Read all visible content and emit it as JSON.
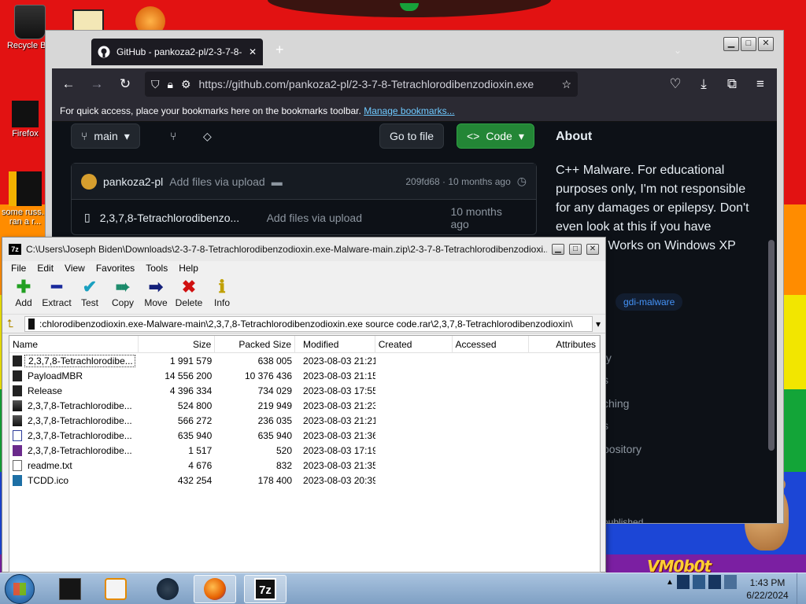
{
  "desktop": {
    "icons": [
      {
        "label": "Recycle Bin"
      },
      {
        "label": "Firefox"
      },
      {
        "label": "some russ... ran a r..."
      }
    ],
    "vm_logo": "VM0b0t"
  },
  "browser": {
    "tab_title": "GitHub - pankoza2-pl/2-3-7-8-",
    "url": "https://github.com/pankoza2-pl/2-3-7-8-Tetrachlorodibenzodioxin.exe",
    "bookmarks_hint": "For quick access, place your bookmarks here on the bookmarks toolbar.",
    "bookmarks_link": "Manage bookmarks...",
    "page": {
      "branch": "main",
      "go_to_file": "Go to file",
      "code_button": "Code",
      "commit": {
        "author": "pankoza2-pl",
        "message": "Add files via upload",
        "hash_time": "209fd68 · 10 months ago"
      },
      "file_row": {
        "name": "2,3,7,8-Tetrachlorodibenzo...",
        "message": "Add files via upload",
        "time": "10 months ago"
      },
      "about": {
        "title": "About",
        "description": "C++ Malware. For educational purposes only, I'm not responsible for any damages or epilepsy. Don't even look at this if you have epilepsy. Works on Windows XP and later",
        "topic": "gdi-malware",
        "links": [
          "ty",
          "s",
          "ching",
          "s",
          "pository",
          "published",
          "s"
        ]
      }
    }
  },
  "sevenzip": {
    "title": "C:\\Users\\Joseph Biden\\Downloads\\2-3-7-8-Tetrachlorodibenzodioxin.exe-Malware-main.zip\\2-3-7-8-Tetrachlorodibenzodioxi...",
    "menu": [
      "File",
      "Edit",
      "View",
      "Favorites",
      "Tools",
      "Help"
    ],
    "toolbar": [
      {
        "label": "Add",
        "icon": "plus-icon",
        "color": "#22a022"
      },
      {
        "label": "Extract",
        "icon": "minus-icon",
        "color": "#1a2a9c"
      },
      {
        "label": "Test",
        "icon": "check-icon",
        "color": "#1aa0c0"
      },
      {
        "label": "Copy",
        "icon": "copy-arrow-icon",
        "color": "#1a8a6a"
      },
      {
        "label": "Move",
        "icon": "move-arrow-icon",
        "color": "#14207a"
      },
      {
        "label": "Delete",
        "icon": "delete-x-icon",
        "color": "#d01010"
      },
      {
        "label": "Info",
        "icon": "info-icon",
        "color": "#c0a000"
      }
    ],
    "address": ":chlorodibenzodioxin.exe-Malware-main\\2,3,7,8-Tetrachlorodibenzodioxin.exe source code.rar\\2,3,7,8-Tetrachlorodibenzodioxin\\",
    "columns": [
      "Name",
      "Size",
      "Packed Size",
      "Modified",
      "Created",
      "Accessed",
      "Attributes"
    ],
    "files": [
      {
        "name": "2,3,7,8-Tetrachlorodibe...",
        "size": "1 991 579",
        "packed": "638 005",
        "modified": "2023-08-03 21:21",
        "type": "folder"
      },
      {
        "name": "PayloadMBR",
        "size": "14 556 200",
        "packed": "10 376 436",
        "modified": "2023-08-03 21:15",
        "type": "folder"
      },
      {
        "name": "Release",
        "size": "4 396 334",
        "packed": "734 029",
        "modified": "2023-08-03 17:55",
        "type": "folder"
      },
      {
        "name": "2,3,7,8-Tetrachlorodibe...",
        "size": "524 800",
        "packed": "219 949",
        "modified": "2023-08-03 21:23",
        "type": "exe"
      },
      {
        "name": "2,3,7,8-Tetrachlorodibe...",
        "size": "566 272",
        "packed": "236 035",
        "modified": "2023-08-03 21:21",
        "type": "exe"
      },
      {
        "name": "2,3,7,8-Tetrachlorodibe...",
        "size": "635 940",
        "packed": "635 940",
        "modified": "2023-08-03 21:36",
        "type": "rar"
      },
      {
        "name": "2,3,7,8-Tetrachlorodibe...",
        "size": "1 517",
        "packed": "520",
        "modified": "2023-08-03 17:19",
        "type": "ps"
      },
      {
        "name": "readme.txt",
        "size": "4 676",
        "packed": "832",
        "modified": "2023-08-03 21:35",
        "type": "txt"
      },
      {
        "name": "TCDD.ico",
        "size": "432 254",
        "packed": "178 400",
        "modified": "2023-08-03 20:39",
        "type": "ico"
      }
    ]
  },
  "taskbar": {
    "time": "1:43 PM",
    "date": "6/22/2024"
  }
}
